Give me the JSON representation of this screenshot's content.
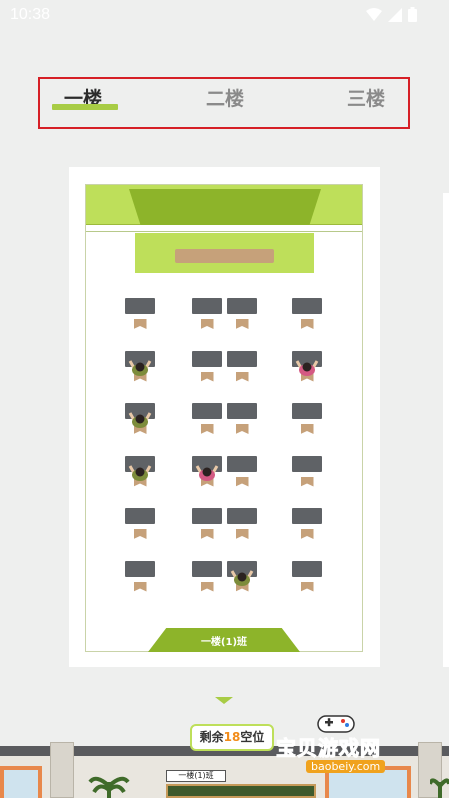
{
  "status_bar": {
    "time": "10:38"
  },
  "floor_tabs": [
    {
      "label": "一楼",
      "active": true
    },
    {
      "label": "二楼",
      "active": false
    },
    {
      "label": "三楼",
      "active": false
    }
  ],
  "classroom": {
    "class_name": "一楼(1)班",
    "seat_rows": [
      [
        "empty",
        "empty",
        "empty",
        "empty"
      ],
      [
        "boy",
        "empty",
        "empty",
        "girl"
      ],
      [
        "boy",
        "empty",
        "empty",
        "empty"
      ],
      [
        "boy",
        "girl",
        "empty",
        "empty"
      ],
      [
        "empty",
        "empty",
        "empty",
        "empty"
      ],
      [
        "empty",
        "empty",
        "boy",
        "empty"
      ]
    ]
  },
  "remaining": {
    "prefix": "剩余",
    "count": "18",
    "suffix": "空位"
  },
  "building": {
    "sign": "一楼(1)班"
  },
  "watermark": {
    "title": "宝贝游戏网",
    "url": "baobeiy.com"
  },
  "colors": {
    "accent": "#a8cc45",
    "highlight_border": "#d61f26",
    "count": "#f28c1a",
    "desk": "#5f6266",
    "chair": "#c6a17a"
  }
}
